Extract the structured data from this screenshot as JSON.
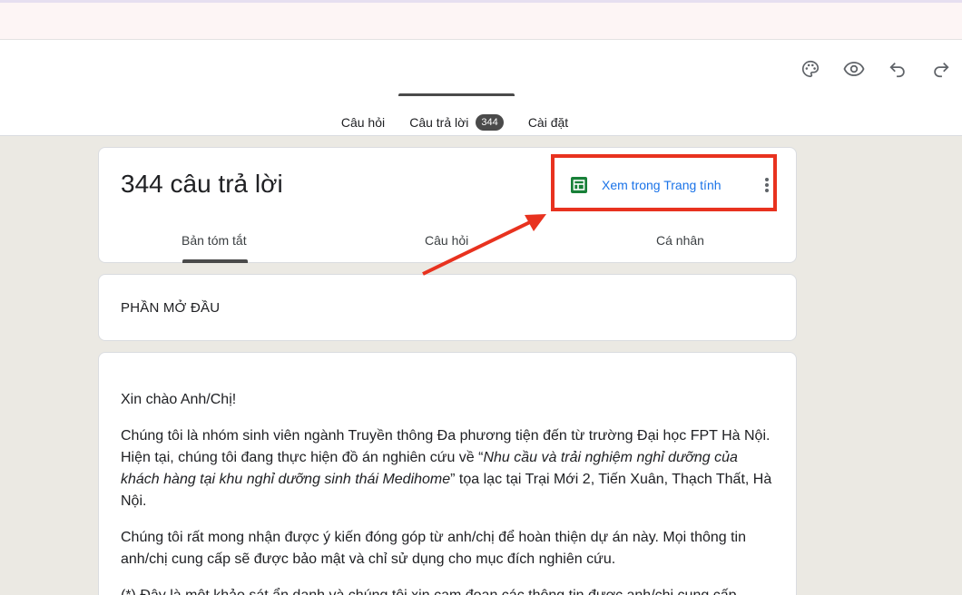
{
  "toolbar": {
    "icons": [
      "palette-icon",
      "eye-icon",
      "undo-icon",
      "redo-icon"
    ]
  },
  "tabs": [
    {
      "label": "Câu hỏi"
    },
    {
      "label": "Câu trả lời",
      "badge": "344"
    },
    {
      "label": "Cài đặt"
    }
  ],
  "responses": {
    "title": "344 câu trả lời",
    "sheets_label": "Xem trong Trang tính",
    "subtabs": [
      "Bản tóm tắt",
      "Câu hỏi",
      "Cá nhân"
    ]
  },
  "section": {
    "title": "PHẦN MỞ ĐẦU"
  },
  "description": {
    "greeting": "Xin chào Anh/Chị!",
    "p1_start": "Chúng tôi là nhóm sinh viên ngành Truyền thông Đa phương tiện đến từ trường Đại học FPT Hà Nội. Hiện tại, chúng tôi đang thực hiện đồ án nghiên cứu về “",
    "p1_italic": "Nhu cầu và trải nghiệm nghỉ dưỡng của khách hàng tại khu nghỉ dưỡng sinh thái Medihome",
    "p1_end": "”  tọa lạc tại Trại Mới 2, Tiến Xuân, Thạch Thất, Hà Nội.",
    "p2": "Chúng tôi rất mong nhận được ý kiến đóng góp từ anh/chị để hoàn thiện dự án này. Mọi thông tin anh/chị cung cấp sẽ được bảo mật và chỉ sử dụng cho mục đích nghiên cứu.",
    "p3": "(*) Đây là một khảo sát ẩn danh và chúng tôi xin cam đoan các thông tin được anh/chị cung cấp"
  },
  "colors": {
    "accent": "#1a73e8",
    "highlight": "#e8321f",
    "sheets_green": "#188038",
    "background": "#ebe9e3"
  }
}
